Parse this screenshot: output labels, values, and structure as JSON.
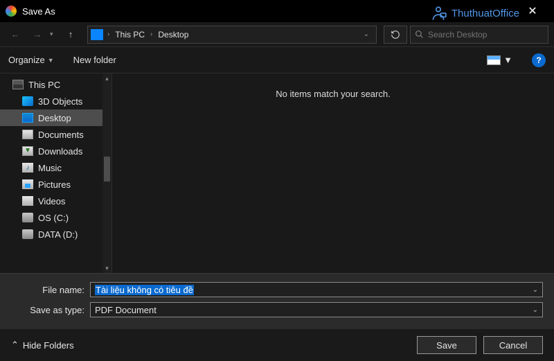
{
  "title": "Save As",
  "watermark": "ThuthuatOffice",
  "address": {
    "root": "This PC",
    "current": "Desktop"
  },
  "search": {
    "placeholder": "Search Desktop"
  },
  "toolbar": {
    "organize": "Organize",
    "newfolder": "New folder"
  },
  "sidebar": {
    "items": [
      {
        "label": "This PC"
      },
      {
        "label": "3D Objects"
      },
      {
        "label": "Desktop"
      },
      {
        "label": "Documents"
      },
      {
        "label": "Downloads"
      },
      {
        "label": "Music"
      },
      {
        "label": "Pictures"
      },
      {
        "label": "Videos"
      },
      {
        "label": "OS (C:)"
      },
      {
        "label": "DATA (D:)"
      }
    ]
  },
  "content": {
    "empty": "No items match your search."
  },
  "form": {
    "filename_label": "File name:",
    "filename_value": "Tài liệu không có tiêu đề",
    "type_label": "Save as type:",
    "type_value": "PDF Document"
  },
  "actions": {
    "hide_folders": "Hide Folders",
    "save": "Save",
    "cancel": "Cancel"
  }
}
